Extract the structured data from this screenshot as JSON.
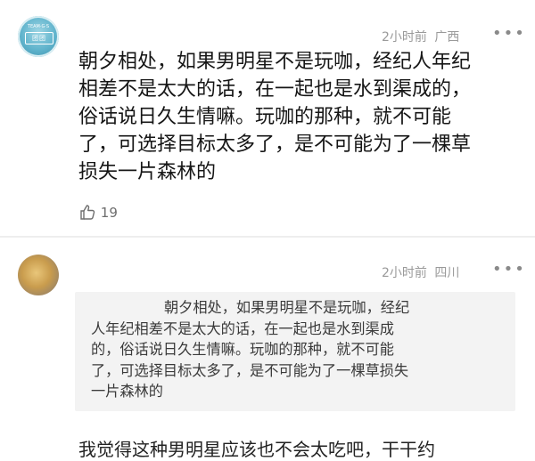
{
  "comments": [
    {
      "avatar": "user-avatar",
      "avatar_logo_top": "TEAM·G·S",
      "avatar_logo": "团团",
      "time": "2小时前",
      "region": "广西",
      "more_icon": "•••",
      "text_lines": [
        "朝夕相处，如果男明星不是玩咖，经纪人年纪",
        "相差不是太大的话，在一起也是水到渠成的，",
        "俗话说日久生情嘛。玩咖的那种，就不可能",
        "了，可选择目标太多了，是不可能为了一棵草",
        "损失一片森林的"
      ],
      "likes": "19",
      "like_icon": "thumbs-up"
    },
    {
      "avatar": "user-avatar",
      "time": "2小时前",
      "region": "四川",
      "more_icon": "•••",
      "quote_lines": [
        "朝夕相处，如果男明星不是玩咖，经纪",
        "人年纪相差不是太大的话，在一起也是水到渠成",
        "的，俗话说日久生情嘛。玩咖的那种，就不可能",
        "了，可选择目标太多了，是不可能为了一棵草损失",
        "一片森林的"
      ],
      "cut_text": "我觉得这种男明星应该也不会太吃吧，干干约"
    }
  ]
}
